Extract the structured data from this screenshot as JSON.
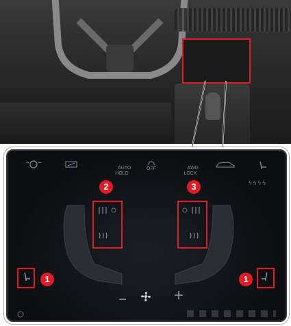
{
  "callouts": {
    "one_left": "1",
    "one_right": "1",
    "two": "2",
    "three": "3"
  },
  "topbar": {
    "auto_hold": "AUTO\nHOLD",
    "hdc": "HDC",
    "abs_off": "OFF",
    "esp_off": "OFF",
    "awd_lock": "AWD\nLOCK"
  },
  "colors": {
    "callout_red": "#e01b24",
    "screen_bg": "#0c0e11",
    "icon_gray": "#8a8f96"
  },
  "icons": [
    "steering-wheel-heat-icon",
    "hdc-icon",
    "auto-hold-icon",
    "esp-off-icon",
    "awd-lock-icon",
    "car-side-icon",
    "seat-icon",
    "seat-heat-icon",
    "seat-ventilation-icon",
    "fan-icon",
    "minus-icon",
    "plus-icon",
    "power-icon"
  ]
}
